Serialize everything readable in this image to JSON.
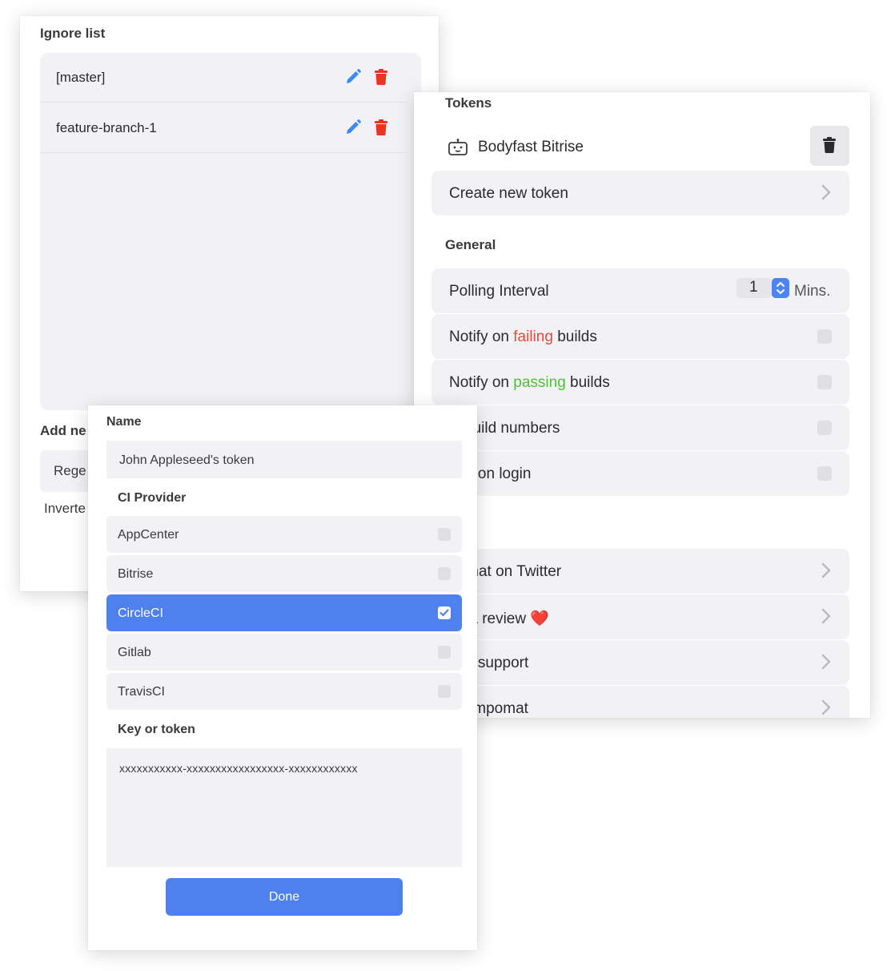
{
  "ignore_list": {
    "title": "Ignore list",
    "items": [
      {
        "label": "[master]"
      },
      {
        "label": "feature-branch-1"
      }
    ],
    "add_new_label": "Add ne",
    "regex_placeholder": "Rege",
    "inverted_label": "Inverte"
  },
  "settings": {
    "tokens_title": "Tokens",
    "token_name": "Bodyfast Bitrise",
    "create_token_label": "Create new token",
    "general_title": "General",
    "polling": {
      "label": "Polling Interval",
      "value": "1",
      "unit": "Mins."
    },
    "notify_failing": {
      "prefix": "Notify on ",
      "highlight": "failing",
      "suffix": " builds",
      "checked": false
    },
    "notify_passing": {
      "prefix": "Notify on ",
      "highlight": "passing",
      "suffix": " builds",
      "checked": false
    },
    "show_build_numbers": {
      "label": "w build numbers",
      "checked": false
    },
    "launch_on_login": {
      "label": "nch on login",
      "checked": false
    },
    "more_title": ":.",
    "links": [
      {
        "label": "pomat on Twitter"
      },
      {
        "label": "ve a review ❤️"
      },
      {
        "label": "tact support"
      },
      {
        "label": ": Tempomat"
      }
    ],
    "colors": {
      "failing": "#e8473b",
      "passing": "#4fbf38",
      "accent": "#4b85f5"
    }
  },
  "dialog": {
    "name_title": "Name",
    "name_value": "John Appleseed's token",
    "ci_title": "CI Provider",
    "providers": [
      {
        "label": "AppCenter",
        "selected": false
      },
      {
        "label": "Bitrise",
        "selected": false
      },
      {
        "label": "CircleCI",
        "selected": true
      },
      {
        "label": "Gitlab",
        "selected": false
      },
      {
        "label": "TravisCI",
        "selected": false
      }
    ],
    "key_title": "Key or token",
    "key_value": "xxxxxxxxxxx-xxxxxxxxxxxxxxxxx-xxxxxxxxxxxx",
    "done_label": "Done",
    "colors": {
      "selected": "#4f81ee"
    }
  }
}
